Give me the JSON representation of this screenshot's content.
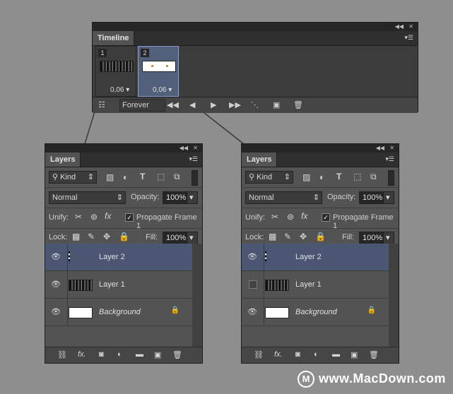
{
  "timeline": {
    "title": "Timeline",
    "frames": [
      {
        "number": "1",
        "delay": "0,06 ▾"
      },
      {
        "number": "2",
        "delay": "0,06 ▾"
      }
    ],
    "loop": "Forever"
  },
  "layers_panels": [
    {
      "title": "Layers",
      "filter_kind": "Kind",
      "blend_mode": "Normal",
      "opacity_label": "Opacity:",
      "opacity": "100%",
      "unify_label": "Unify:",
      "propagate_label": "Propagate Frame 1",
      "lock_label": "Lock:",
      "fill_label": "Fill:",
      "fill": "100%",
      "layers": [
        {
          "name": "Layer 2",
          "visible": true
        },
        {
          "name": "Layer 1",
          "visible": true
        },
        {
          "name": "Background",
          "visible": true
        }
      ]
    },
    {
      "title": "Layers",
      "filter_kind": "Kind",
      "blend_mode": "Normal",
      "opacity_label": "Opacity:",
      "opacity": "100%",
      "unify_label": "Unify:",
      "propagate_label": "Propagate Frame 1",
      "lock_label": "Lock:",
      "fill_label": "Fill:",
      "fill": "100%",
      "layers": [
        {
          "name": "Layer 2",
          "visible": true
        },
        {
          "name": "Layer 1",
          "visible": false
        },
        {
          "name": "Background",
          "visible": true
        }
      ]
    }
  ],
  "watermark": "www.MacDown.com",
  "watermark_logo": "M"
}
